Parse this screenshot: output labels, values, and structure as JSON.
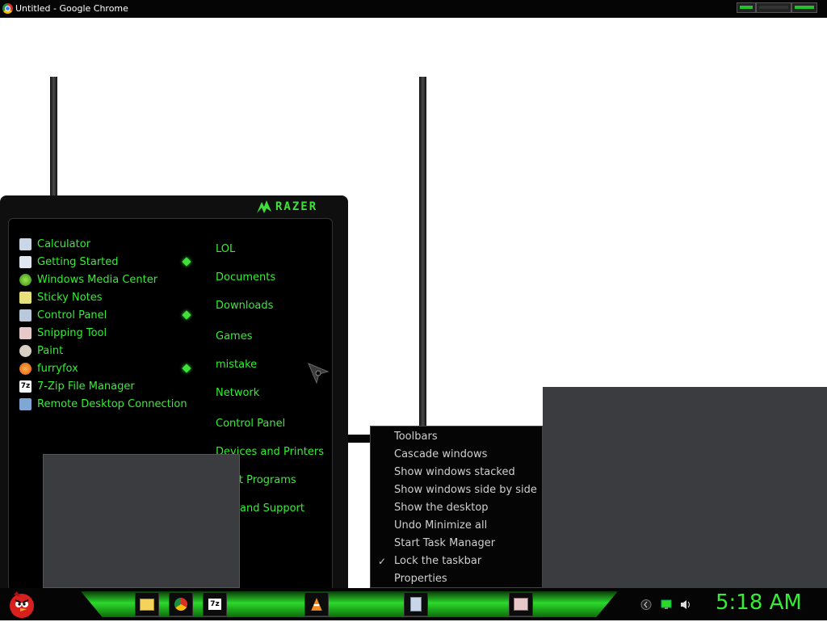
{
  "window": {
    "title": "Untitled - Google Chrome"
  },
  "start_menu": {
    "brand": "RAZER",
    "programs": [
      {
        "label": "Calculator",
        "icon": "calculator-icon"
      },
      {
        "label": "Getting Started",
        "icon": "getting-started-icon",
        "has_submenu": true
      },
      {
        "label": "Windows Media Center",
        "icon": "media-center-icon"
      },
      {
        "label": "Sticky Notes",
        "icon": "sticky-notes-icon"
      },
      {
        "label": "Control Panel",
        "icon": "control-panel-icon",
        "has_submenu": true
      },
      {
        "label": "Snipping Tool",
        "icon": "snipping-tool-icon"
      },
      {
        "label": "Paint",
        "icon": "paint-icon"
      },
      {
        "label": "furryfox",
        "icon": "firefox-icon",
        "has_submenu": true
      },
      {
        "label": "7-Zip File Manager",
        "icon": "7zip-icon"
      },
      {
        "label": "Remote Desktop Connection",
        "icon": "remote-desktop-icon"
      }
    ],
    "places": [
      "LOL",
      "Documents",
      "Downloads",
      "Games",
      "mistake",
      "Network",
      "Control Panel",
      "Devices and Printers",
      "ult Programs",
      "and Support"
    ]
  },
  "context_menu": {
    "items": [
      {
        "label": "Toolbars"
      },
      {
        "label": "Cascade windows"
      },
      {
        "label": "Show windows stacked"
      },
      {
        "label": "Show windows side by side"
      },
      {
        "label": "Show the desktop"
      },
      {
        "label": "Undo Minimize all"
      },
      {
        "label": "Start Task Manager"
      },
      {
        "label": "Lock the taskbar",
        "checked": true
      },
      {
        "label": "Properties"
      }
    ],
    "check_mark": "✓"
  },
  "taskbar": {
    "clock": "5:18 AM",
    "pinned": [
      "explorer-icon",
      "chrome-icon",
      "7zip-icon",
      "vlc-icon",
      "calculator-icon",
      "snipping-tool-icon"
    ]
  },
  "colors": {
    "accent": "#33ee33",
    "menu_bg": "#000000",
    "context_text": "#cfcfcf"
  }
}
